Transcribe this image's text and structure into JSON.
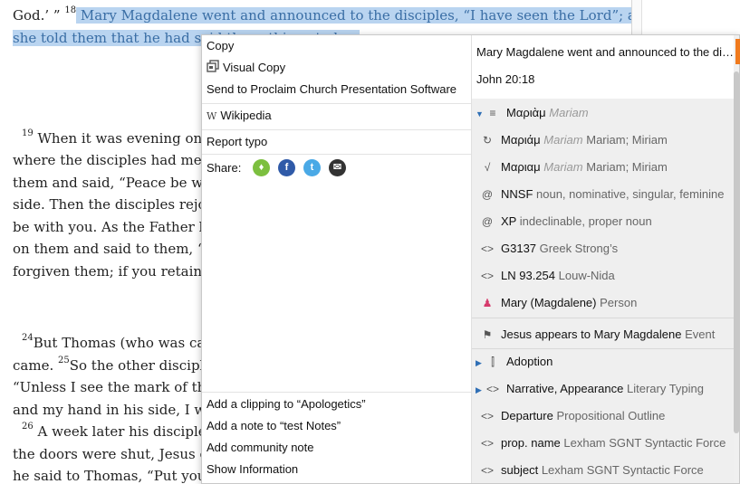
{
  "reader": {
    "lines": [
      {
        "pre": "God.’ ” ",
        "v": "18",
        "sel": " Mary Magdalene went and announced to the disciples, “I have seen the Lord”; and"
      },
      {
        "sel": "she told them that he had said these things to her."
      },
      {
        "v": "19",
        "text": " When it was evening on t"
      },
      {
        "text": "where the disciples had met w"
      },
      {
        "text": "them and said, “Peace be with"
      },
      {
        "text": "side. Then the disciples rejoic"
      },
      {
        "text": "be with you. As the Father has"
      },
      {
        "text": "on them and said to them, “Re"
      },
      {
        "text": "forgiven them; if you retain th"
      },
      {
        "v": "24",
        "text": "But Thomas (who was calle"
      },
      {
        "text": "came. ",
        "v2": "25",
        "text2": "So the other disciple"
      },
      {
        "text": "“Unless I see the mark of the"
      },
      {
        "text": "and my hand in his side, I will"
      },
      {
        "v": "26",
        "text": " A week later his disciples w"
      },
      {
        "text": "the doors were shut, Jesus can"
      },
      {
        "text": "he said to Thomas, “Put your fi"
      }
    ]
  },
  "menu": {
    "copy": "Copy",
    "visual_copy": "Visual Copy",
    "send_to": "Send to Proclaim Church Presentation Software",
    "wikipedia": "Wikipedia",
    "report_typo": "Report typo",
    "share_label": "Share:",
    "add_clipping": "Add a clipping to “Apologetics”",
    "add_note": "Add a note to “test Notes”",
    "add_community_note": "Add community note",
    "show_information": "Show Information"
  },
  "info": {
    "title": "Mary Magdalene went and announced to the disciples, “I have seen the Lord”; and",
    "reference": "John 20:18",
    "items": [
      {
        "icon": "lemma-icon",
        "glyph": "≡",
        "twisty": "▼",
        "main": "Μαριὰμ",
        "gr": "Mariam",
        "sub": ""
      },
      {
        "icon": "inflected-icon",
        "glyph": "↻",
        "main": "Μαριάμ",
        "gr": "Mariam",
        "sub": "Mariam; Miriam"
      },
      {
        "icon": "root-icon",
        "glyph": "√",
        "main": "Μαριαμ",
        "gr": "Mariam",
        "sub": "Mariam; Miriam"
      },
      {
        "icon": "morph-icon",
        "glyph": "@",
        "main": "NNSF",
        "gr": "",
        "sub": "noun, nominative, singular, feminine"
      },
      {
        "icon": "morph-icon",
        "glyph": "@",
        "main": "XP",
        "gr": "",
        "sub": "indeclinable, proper noun"
      },
      {
        "icon": "code-icon",
        "glyph": "<>",
        "main": "G3137",
        "gr": "",
        "sub": "Greek Strong’s"
      },
      {
        "icon": "code-icon",
        "glyph": "<>",
        "main": "LN 93.254",
        "gr": "",
        "sub": "Louw-Nida"
      },
      {
        "icon": "person-icon",
        "glyph": "♟",
        "main": "Mary (Magdalene)",
        "gr": "",
        "sub": "Person"
      },
      {
        "icon": "flag-icon",
        "glyph": "⚑",
        "main": "Jesus appears to Mary Magdalene",
        "gr": "",
        "sub": "Event"
      },
      {
        "icon": "pillar-icon",
        "glyph": "⫿",
        "twisty": "▶",
        "main": "Adoption",
        "gr": "",
        "sub": ""
      },
      {
        "icon": "code-icon",
        "glyph": "<>",
        "twisty": "▶",
        "main": "Narrative, Appearance",
        "gr": "",
        "sub": "Literary Typing"
      },
      {
        "icon": "code-icon",
        "glyph": "<>",
        "main": "Departure",
        "gr": "",
        "sub": "Propositional Outline"
      },
      {
        "icon": "code-icon",
        "glyph": "<>",
        "main": "prop. name",
        "gr": "",
        "sub": "Lexham SGNT Syntactic Force"
      },
      {
        "icon": "code-icon",
        "glyph": "<>",
        "main": "subject",
        "gr": "",
        "sub": "Lexham SGNT Syntactic Force"
      }
    ]
  },
  "colors": {
    "selection_bg": "#b9d4f0",
    "selection_text": "#3a6ea5",
    "accent_orange": "#f07a1d",
    "person_pink": "#d63a6c"
  }
}
